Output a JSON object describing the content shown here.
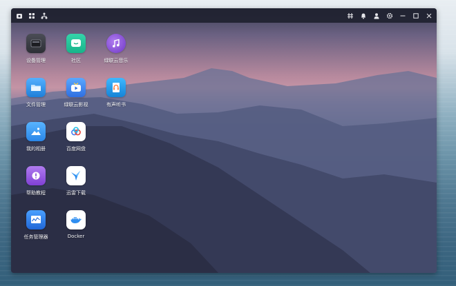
{
  "titlebar": {
    "left_icons": [
      "home-icon",
      "grid-icon",
      "network-icon"
    ],
    "right_icons": [
      "pin-icon",
      "bell-icon",
      "user-icon",
      "gear-icon",
      "minimize-icon",
      "maximize-icon",
      "close-icon"
    ]
  },
  "apps": [
    {
      "id": "device",
      "label": "设备管理",
      "icon": "device-icon"
    },
    {
      "id": "community",
      "label": "社区",
      "icon": "chat-icon"
    },
    {
      "id": "music",
      "label": "绿联云音乐",
      "icon": "music-icon"
    },
    {
      "id": "files",
      "label": "文件管理",
      "icon": "folder-icon"
    },
    {
      "id": "video",
      "label": "绿联云影视",
      "icon": "tv-icon"
    },
    {
      "id": "audiobook",
      "label": "有声听书",
      "icon": "headphones-icon"
    },
    {
      "id": "photos",
      "label": "我的相册",
      "icon": "photo-icon"
    },
    {
      "id": "baidu",
      "label": "百度网盘",
      "icon": "cloud-icon"
    },
    {
      "id": "help",
      "label": "帮助教程",
      "icon": "help-icon"
    },
    {
      "id": "thunder",
      "label": "迅雷下载",
      "icon": "bird-icon"
    },
    {
      "id": "taskmgr",
      "label": "任务管理器",
      "icon": "monitor-icon"
    },
    {
      "id": "docker",
      "label": "Docker",
      "icon": "docker-icon"
    }
  ],
  "colors": {
    "titlebar": "#202230",
    "community": "#22c39a",
    "music": "#8a4fd8",
    "files": "#2f8fe8",
    "photos": "#3a9bf0",
    "help": "#9b5fe0"
  }
}
